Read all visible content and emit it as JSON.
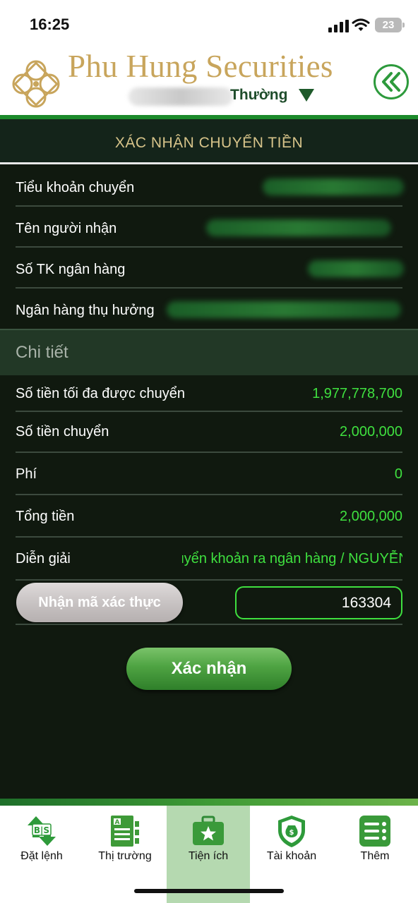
{
  "status_bar": {
    "time": "16:25",
    "battery": "23"
  },
  "header": {
    "brand": "Phu Hung Securities",
    "account_type": "Thường"
  },
  "page": {
    "title": "XÁC NHẬN CHUYỂN TIỀN"
  },
  "transfer_info": {
    "rows": [
      {
        "label": "Tiểu khoản chuyển"
      },
      {
        "label": "Tên người nhận"
      },
      {
        "label": "Số TK ngân hàng"
      },
      {
        "label": "Ngân hàng thụ hưởng"
      }
    ]
  },
  "details": {
    "section_title": "Chi tiết",
    "rows": [
      {
        "label": "Số tiền tối đa được chuyển",
        "value": "1,977,778,700"
      },
      {
        "label": "Số tiền chuyển",
        "value": "2,000,000"
      },
      {
        "label": "Phí",
        "value": "0"
      },
      {
        "label": "Tổng tiền",
        "value": "2,000,000"
      },
      {
        "label": "Diễn giải",
        "value": "Chuyển khoản ra ngân hàng / NGUYỄN HỒ"
      }
    ]
  },
  "otp": {
    "button_label": "Nhận mã xác thực",
    "value": "163304"
  },
  "confirm": {
    "label": "Xác nhận"
  },
  "nav": {
    "items": [
      {
        "label": "Đặt lệnh"
      },
      {
        "label": "Thị trường"
      },
      {
        "label": "Tiện ích"
      },
      {
        "label": "Tài khoản"
      },
      {
        "label": "Thêm"
      }
    ],
    "active_index": 2
  },
  "colors": {
    "brand_gold": "#c8a55c",
    "accent_green": "#3fe03f",
    "background_dark": "#10190f"
  }
}
